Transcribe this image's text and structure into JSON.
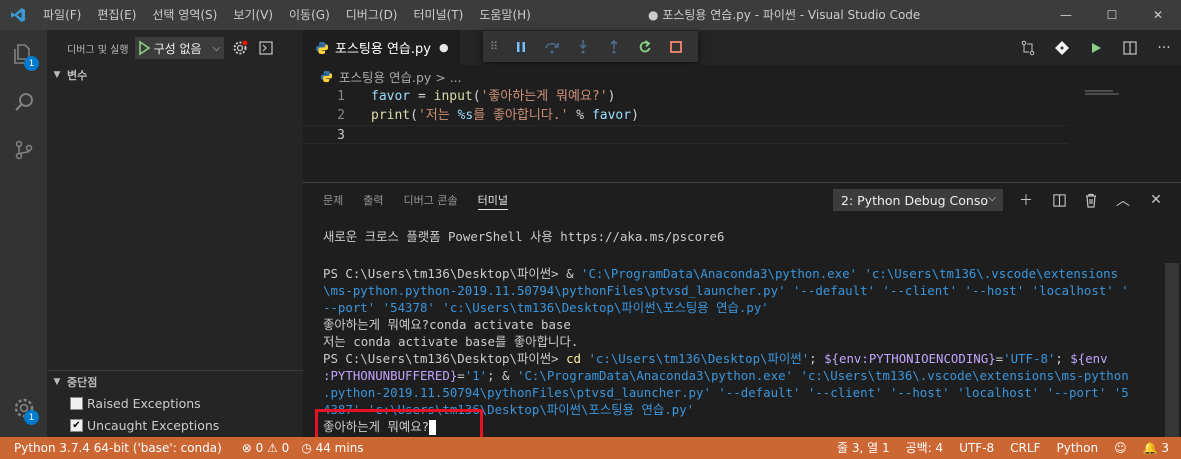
{
  "titlebar": {
    "menu": [
      "파일(F)",
      "편집(E)",
      "선택 영역(S)",
      "보기(V)",
      "이동(G)",
      "디버그(D)",
      "터미널(T)",
      "도움말(H)"
    ],
    "window_title": "● 포스팅용 연습.py - 파이썬 - Visual Studio Code",
    "minimize": "—",
    "maximize": "☐",
    "close": "✕"
  },
  "activitybar": {
    "explorer_badge": "1",
    "settings_badge": "1"
  },
  "sidebar": {
    "debug_title": "디버그 및 실행",
    "config_select": "구성 없음",
    "variables_header": "변수",
    "breakpoints_header": "중단점",
    "breakpoints": [
      {
        "label": "Raised Exceptions",
        "checked": false
      },
      {
        "label": "Uncaught Exceptions",
        "checked": true
      }
    ]
  },
  "editor": {
    "tab_label": "포스팅용 연습.py",
    "tab_modified": "●",
    "breadcrumb": "포스팅용 연습.py > ...",
    "lines": [
      {
        "num": "1",
        "tokens": [
          {
            "t": "favor",
            "c": "tok-var"
          },
          {
            "t": " = ",
            "c": "tok-op"
          },
          {
            "t": "input",
            "c": "tok-fn"
          },
          {
            "t": "(",
            "c": "tok-op"
          },
          {
            "t": "'좋아하는게 뭐예요?'",
            "c": "tok-str"
          },
          {
            "t": ")",
            "c": "tok-op"
          }
        ]
      },
      {
        "num": "2",
        "tokens": [
          {
            "t": "print",
            "c": "tok-fn"
          },
          {
            "t": "(",
            "c": "tok-op"
          },
          {
            "t": "'저는 ",
            "c": "tok-str"
          },
          {
            "t": "%s",
            "c": "tok-fmt"
          },
          {
            "t": "를 좋아합니다.'",
            "c": "tok-str"
          },
          {
            "t": " % ",
            "c": "tok-op"
          },
          {
            "t": "favor",
            "c": "tok-var"
          },
          {
            "t": ")",
            "c": "tok-op"
          }
        ]
      },
      {
        "num": "3",
        "tokens": []
      }
    ]
  },
  "panel": {
    "tabs": [
      "문제",
      "출력",
      "디버그 콘솔",
      "터미널"
    ],
    "active_tab": "터미널",
    "terminal_select": "2: Python Debug Conso",
    "terminal_lines": [
      [
        {
          "t": "새로운 크로스 플랫폼 PowerShell 사용 https://aka.ms/pscore6",
          "c": "t-gray"
        }
      ],
      [],
      [
        {
          "t": "PS C:\\Users\\tm136\\Desktop\\파이썬> ",
          "c": "t-gray"
        },
        {
          "t": "& ",
          "c": "t-gray"
        },
        {
          "t": "'C:\\ProgramData\\Anaconda3\\python.exe' 'c:\\Users\\tm136\\.vscode\\extensions",
          "c": "t-str"
        }
      ],
      [
        {
          "t": "\\ms-python.python-2019.11.50794\\pythonFiles\\ptvsd_launcher.py' '--default' '--client' '--host' 'localhost' '",
          "c": "t-str"
        }
      ],
      [
        {
          "t": "--port' '54378' 'c:\\Users\\tm136\\Desktop\\파이썬\\포스팅용 연습.py'",
          "c": "t-str"
        }
      ],
      [
        {
          "t": "좋아하는게 뭐예요?conda activate base",
          "c": "t-gray"
        }
      ],
      [
        {
          "t": "저는 conda activate base를 좋아합니다.",
          "c": "t-gray"
        }
      ],
      [
        {
          "t": "PS C:\\Users\\tm136\\Desktop\\파이썬> ",
          "c": "t-gray"
        },
        {
          "t": "cd ",
          "c": "t-yel"
        },
        {
          "t": "'c:\\Users\\tm136\\Desktop\\파이썬'",
          "c": "t-str"
        },
        {
          "t": "; ",
          "c": "t-gray"
        },
        {
          "t": "${env:PYTHONIOENCODING}",
          "c": "t-var"
        },
        {
          "t": "=",
          "c": "t-gray"
        },
        {
          "t": "'UTF-8'",
          "c": "t-str"
        },
        {
          "t": "; ",
          "c": "t-gray"
        },
        {
          "t": "${env",
          "c": "t-var"
        }
      ],
      [
        {
          "t": ":PYTHONUNBUFFERED}",
          "c": "t-var"
        },
        {
          "t": "=",
          "c": "t-gray"
        },
        {
          "t": "'1'",
          "c": "t-str"
        },
        {
          "t": "; & ",
          "c": "t-gray"
        },
        {
          "t": "'C:\\ProgramData\\Anaconda3\\python.exe' 'c:\\Users\\tm136\\.vscode\\extensions\\ms-python",
          "c": "t-str"
        }
      ],
      [
        {
          "t": ".python-2019.11.50794\\pythonFiles\\ptvsd_launcher.py' '--default' '--client' '--host' 'localhost' '--port' '5",
          "c": "t-str"
        }
      ],
      [
        {
          "t": "4387' 'c:\\Users\\tm136\\Desktop\\파이썬\\포스팅용 연습.py'",
          "c": "t-str"
        }
      ],
      [
        {
          "t": "좋아하는게 뭐예요?",
          "c": "t-gray"
        },
        {
          "cursor": true
        }
      ]
    ]
  },
  "statusbar": {
    "python": "Python 3.7.4 64-bit ('base': conda)",
    "problems": "⊗ 0 ⚠ 0",
    "time": "◷ 44 mins",
    "position": "줄 3, 열 1",
    "spaces": "공백: 4",
    "encoding": "UTF-8",
    "eol": "CRLF",
    "language": "Python",
    "feedback": "☺",
    "notifications": "🔔 3"
  },
  "colors": {
    "statusbar": "#cc6633",
    "accent": "#007acc",
    "highlight": "#e81123"
  }
}
